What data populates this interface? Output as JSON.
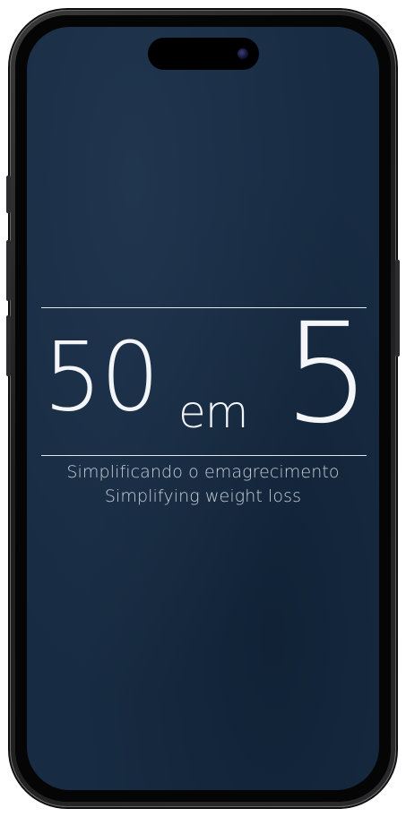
{
  "splash": {
    "logo": {
      "part1": "50",
      "part2": "em",
      "part3": "5"
    },
    "tagline_pt": "Simplificando o emagrecimento",
    "tagline_en": "Simplifying weight loss"
  },
  "colors": {
    "background": "#172b42",
    "text": "#f3f5f8",
    "subtext": "#c9d1da",
    "rule": "#dfe6ee",
    "device_frame": "#1c1c1e"
  }
}
